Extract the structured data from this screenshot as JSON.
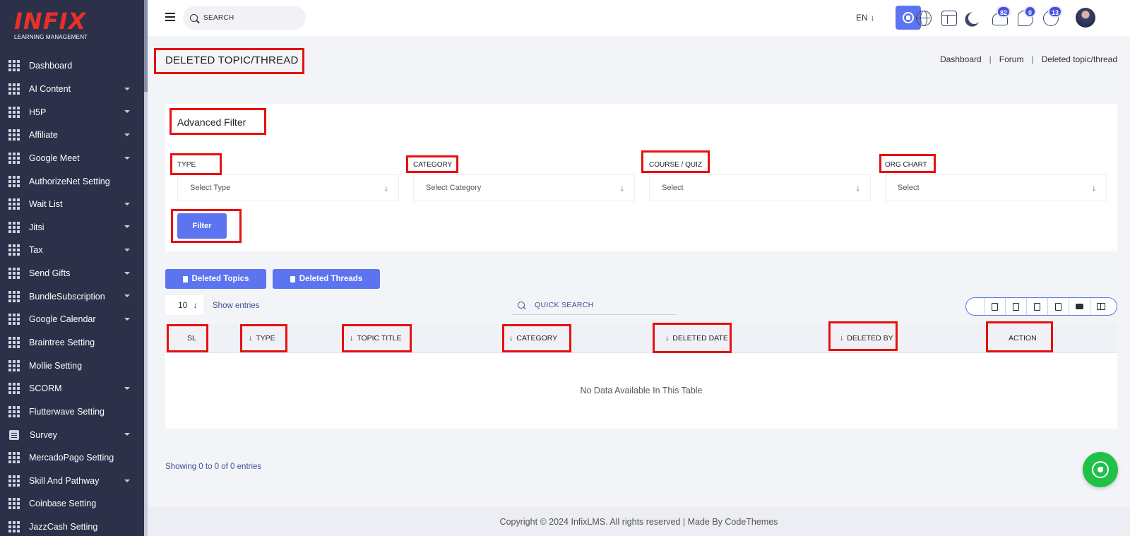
{
  "logo": {
    "word": "INFIX",
    "subtitle": "LEARNING MANAGEMENT"
  },
  "sidebar": {
    "items": [
      {
        "label": "Dashboard",
        "has_caret": false
      },
      {
        "label": "AI Content",
        "has_caret": true
      },
      {
        "label": "H5P",
        "has_caret": true
      },
      {
        "label": "Affiliate",
        "has_caret": true
      },
      {
        "label": "Google Meet",
        "has_caret": true
      },
      {
        "label": "AuthorizeNet Setting",
        "has_caret": false
      },
      {
        "label": "Wait List",
        "has_caret": true
      },
      {
        "label": "Jitsi",
        "has_caret": true
      },
      {
        "label": "Tax",
        "has_caret": true
      },
      {
        "label": "Send Gifts",
        "has_caret": true
      },
      {
        "label": "BundleSubscription",
        "has_caret": true
      },
      {
        "label": "Google Calendar",
        "has_caret": true
      },
      {
        "label": "Braintree Setting",
        "has_caret": false
      },
      {
        "label": "Mollie Setting",
        "has_caret": false
      },
      {
        "label": "SCORM",
        "has_caret": true
      },
      {
        "label": "Flutterwave Setting",
        "has_caret": false
      },
      {
        "label": "Survey",
        "has_caret": true
      },
      {
        "label": "MercadoPago Setting",
        "has_caret": false
      },
      {
        "label": "Skill And Pathway",
        "has_caret": true
      },
      {
        "label": "Coinbase Setting",
        "has_caret": false
      },
      {
        "label": "JazzCash Setting",
        "has_caret": false
      }
    ]
  },
  "topbar": {
    "search_placeholder": "SEARCH",
    "language": "EN",
    "notifications_count": "82",
    "messages_count": "0",
    "whatsapp_count": "13"
  },
  "page": {
    "title": "DELETED TOPIC/THREAD",
    "breadcrumb": [
      "Dashboard",
      "Forum",
      "Deleted topic/thread"
    ]
  },
  "filter": {
    "title": "Advanced Filter",
    "fields": [
      {
        "label": "TYPE",
        "value": "Select Type"
      },
      {
        "label": "CATEGORY",
        "value": "Select Category"
      },
      {
        "label": "COURSE / QUIZ",
        "value": "Select"
      },
      {
        "label": "ORG CHART",
        "value": "Select"
      }
    ],
    "button": "Filter"
  },
  "tabs": [
    "Deleted Topics",
    "Deleted Threads"
  ],
  "table": {
    "entries_value": "10",
    "show_entries": "Show entries",
    "quick_search": "QUICK SEARCH",
    "columns": [
      "SL",
      "TYPE",
      "TOPIC TITLE",
      "CATEGORY",
      "DELETED DATE",
      "DELETED BY",
      "ACTION"
    ],
    "empty_message": "No Data Available In This Table",
    "showing": "Showing 0 to 0 of 0 entries"
  },
  "footer": {
    "text": "Copyright © 2024 InfixLMS. All rights reserved | Made By CodeThemes"
  },
  "colors": {
    "sidebar": "#2c3048",
    "accent": "#5c74f0",
    "annotation": "#e8100f",
    "whatsapp": "#1fc146"
  }
}
